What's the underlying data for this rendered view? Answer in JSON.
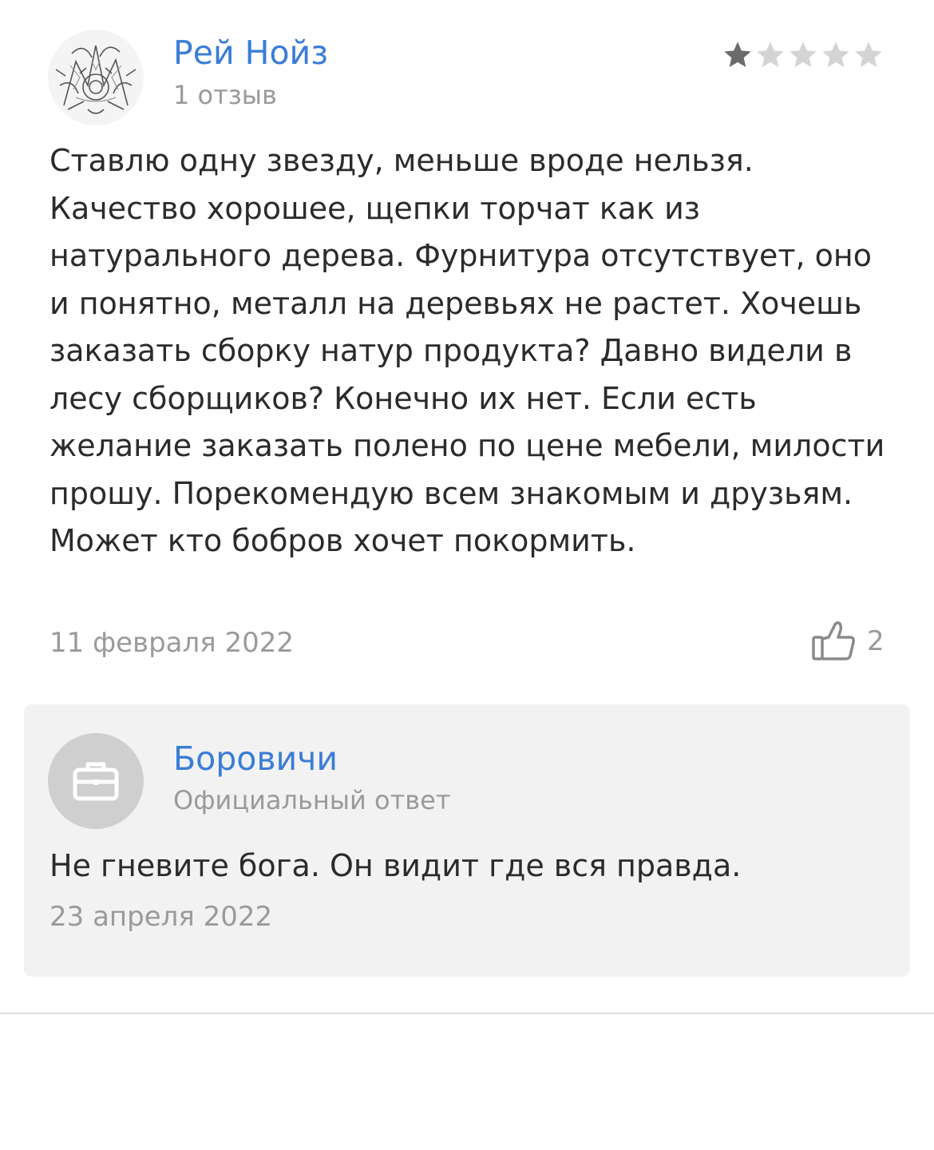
{
  "review": {
    "author_name": "Рей Нойз",
    "author_reviews": "1 отзыв",
    "rating": 1,
    "rating_max": 5,
    "text": "Ставлю одну звезду, меньше вроде нельзя. Качество хорошее, щепки торчат как из натурального дерева. Фурнитура отсутствует, оно и понятно, металл на деревьях не растет. Хочешь заказать сборку натур продукта? Давно видели в лесу сборщиков? Конечно их нет. Если есть желание заказать полено по цене мебели, милости прошу. Порекомендую всем знакомым и друзьям. Может кто бобров хочет покормить.",
    "date": "11 февраля 2022",
    "likes": "2",
    "icons": {
      "like": "thumbs-up-icon",
      "star": "star-icon"
    }
  },
  "reply": {
    "org_name": "Боровичи",
    "label": "Официальный ответ",
    "text": "Не гневите бога. Он видит где вся правда.",
    "date": "23 апреля 2022",
    "icon": "briefcase-icon"
  },
  "colors": {
    "link": "#3a7dd6",
    "text": "#2b2b2b",
    "muted": "#9a9a9a",
    "star_filled": "#6b6b6b",
    "star_empty": "#d4d4d4",
    "reply_bg": "#f2f2f2",
    "org_avatar_bg": "#cfcfcf"
  }
}
